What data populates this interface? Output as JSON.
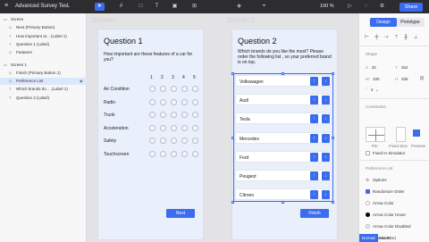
{
  "topbar": {
    "title": "Advanced Survey Test",
    "zoom": "100 %",
    "share_label": "Share"
  },
  "layers": [
    {
      "label": "Screen",
      "icon": "screen-icon",
      "indent": 0,
      "selected": false
    },
    {
      "label": "Next (Primary Button)",
      "icon": "component-icon",
      "indent": 1,
      "selected": false
    },
    {
      "label": "How important ar... (Label 1)",
      "icon": "text-icon",
      "indent": 1,
      "selected": false
    },
    {
      "label": "Question 1 (Label)",
      "icon": "text-icon",
      "indent": 1,
      "selected": false
    },
    {
      "label": "Features",
      "icon": "component-icon",
      "indent": 1,
      "selected": false
    },
    {
      "label": "Screen 1",
      "icon": "screen-icon",
      "indent": 0,
      "selected": false
    },
    {
      "label": "Finish (Primary Button 1)",
      "icon": "component-icon",
      "indent": 1,
      "selected": false
    },
    {
      "label": "Preference List",
      "icon": "component-icon",
      "indent": 1,
      "selected": true
    },
    {
      "label": "Which brands do ... (Label 1)",
      "icon": "text-icon",
      "indent": 1,
      "selected": false
    },
    {
      "label": "Question 2 (Label)",
      "icon": "text-icon",
      "indent": 1,
      "selected": false
    }
  ],
  "canvas": {
    "ghost_left": "Screen",
    "ghost_right": "Screen 1"
  },
  "screen1": {
    "title": "Question 1",
    "question": "How important are these features of a car for you?",
    "scale": [
      "1",
      "2",
      "3",
      "4",
      "5"
    ],
    "attributes": [
      "Air Condition",
      "Radio",
      "Trunk",
      "Acceleration",
      "Safety",
      "Touchscreen"
    ],
    "button": "Next"
  },
  "screen2": {
    "title": "Question 2",
    "question": "Which brands do you like the most? Please order the following list , so your preferred brand is on top.",
    "brands": [
      "Volkswagen",
      "Audi",
      "Tesla",
      "Mercedes",
      "Ford",
      "Peugeot",
      "Citroen"
    ],
    "up_arrow": "↑",
    "down_arrow": "↓",
    "button": "Finish"
  },
  "inspector": {
    "tab_design": "Design",
    "tab_prototype": "Prototype",
    "shape_label": "Shape",
    "x_key": "X",
    "x_value": "32",
    "y_key": "Y",
    "y_value": "152",
    "w_key": "W",
    "w_value": "100",
    "h_key": "H",
    "h_value": "335",
    "radius_value": "4",
    "constraints_label": "Constraints",
    "pin_label": "Pin",
    "fixed_size_label": "Fixed Size",
    "preview_label": "Preview",
    "fixed_in_sim_label": "Fixed In Simulator",
    "pref_list_label": "Preference List",
    "options_label": "Options",
    "randomize_label": "Randomize Order",
    "arrow_color_label": "Arrow Color",
    "arrow_hover_label": "Arrow Color Hover",
    "arrow_disabled_label": "Arrow Color Disabled",
    "button_size_value": "24",
    "button_size_label": "(Button Size)",
    "state_normal": "Normal",
    "state_hover": "Hover"
  },
  "colors": {
    "accent": "#3b6cf0",
    "topbar": "#2d2d30",
    "screen_bg": "#e9effb"
  }
}
